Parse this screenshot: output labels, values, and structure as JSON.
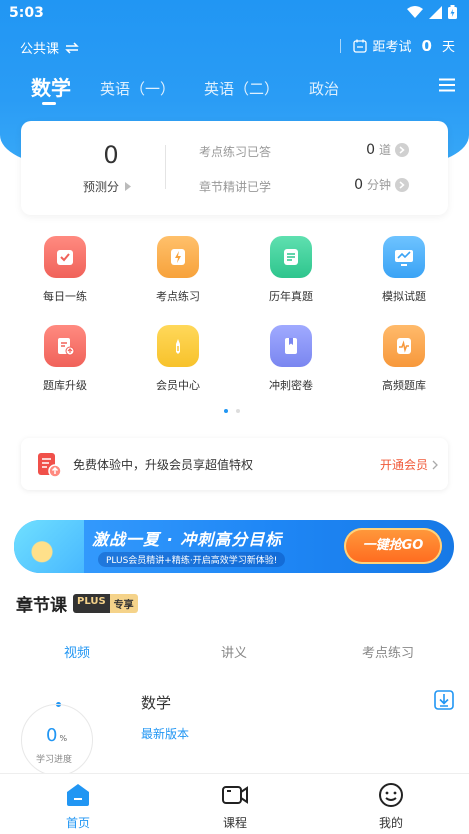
{
  "status_bar": {
    "time": "5:03"
  },
  "header": {
    "course_switch_label": "公共课",
    "exam_countdown_label": "距考试",
    "exam_countdown_days": "0",
    "exam_countdown_unit": "天"
  },
  "subject_tabs": [
    {
      "label": "数学",
      "active": true
    },
    {
      "label": "英语（一）",
      "active": false
    },
    {
      "label": "英语（二）",
      "active": false
    },
    {
      "label": "政治",
      "active": false
    }
  ],
  "stats": {
    "predicted_score": "0",
    "predicted_score_label": "预测分",
    "answered_label": "考点练习已答",
    "answered_value": "0",
    "answered_unit": "道",
    "studied_label": "章节精讲已学",
    "studied_value": "0",
    "studied_unit": "分钟"
  },
  "features": [
    {
      "label": "每日一练",
      "icon": "calendar-check-icon",
      "color": "#f0625a"
    },
    {
      "label": "考点练习",
      "icon": "lightning-doc-icon",
      "color": "#f7a23b"
    },
    {
      "label": "历年真题",
      "icon": "document-icon",
      "color": "#2ec58d"
    },
    {
      "label": "模拟试题",
      "icon": "monitor-chart-icon",
      "color": "#3aa3f5"
    },
    {
      "label": "题库升级",
      "icon": "doc-upgrade-icon",
      "color": "#f0625a"
    },
    {
      "label": "会员中心",
      "icon": "crown-badge-icon",
      "color": "#f7c22b"
    },
    {
      "label": "冲刺密卷",
      "icon": "book-icon",
      "color": "#7a86f0"
    },
    {
      "label": "高频题库",
      "icon": "pulse-doc-icon",
      "color": "#f7983b"
    }
  ],
  "promo": {
    "text": "免费体验中，升级会员享超值特权",
    "cta": "开通会员"
  },
  "banner": {
    "headline": "激战一夏 · 冲刺高分目标",
    "subline": "PLUS会员精讲+精练·开启高效学习新体验!",
    "button": "一键抢GO"
  },
  "chapter_section": {
    "title": "章节课",
    "badge_plus": "PLUS",
    "badge_exclusive": "专享",
    "tabs": [
      "视频",
      "讲义",
      "考点练习"
    ],
    "active_tab": 0,
    "course_name": "数学",
    "course_version": "最新版本",
    "progress_value": "0",
    "progress_unit": "%",
    "progress_label": "学习进度"
  },
  "bottom_nav": [
    {
      "label": "首页",
      "icon": "home-icon",
      "active": true
    },
    {
      "label": "课程",
      "icon": "video-camera-icon",
      "active": false
    },
    {
      "label": "我的",
      "icon": "smiley-icon",
      "active": false
    }
  ],
  "colors": {
    "primary": "#2196f3",
    "accent_red": "#f05a3a",
    "banner_orange": "#ff6a1f"
  }
}
